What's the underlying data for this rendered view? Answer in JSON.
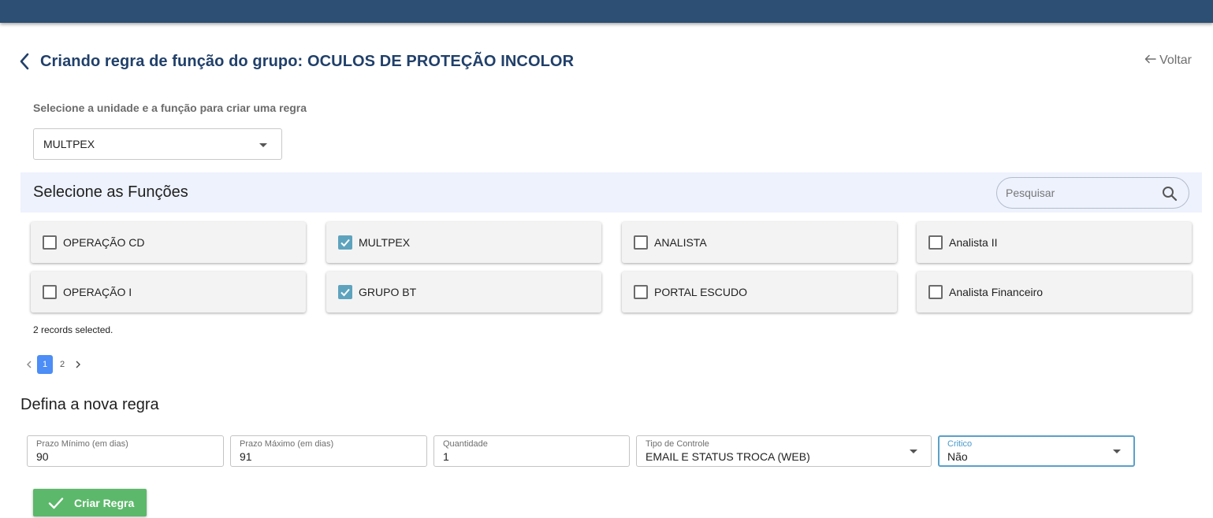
{
  "header": {
    "title": "Criando regra de função do grupo: OCULOS DE PROTEÇÃO INCOLOR",
    "back_link_label": "Voltar"
  },
  "unit": {
    "instruction": "Selecione a unidade e a função para criar uma regra",
    "selected": "MULTPEX"
  },
  "functions": {
    "title": "Selecione as Funções",
    "search_placeholder": "Pesquisar",
    "items": [
      {
        "label": "OPERAÇÃO CD",
        "checked": false
      },
      {
        "label": "MULTPEX",
        "checked": true
      },
      {
        "label": "ANALISTA",
        "checked": false
      },
      {
        "label": "Analista II",
        "checked": false
      },
      {
        "label": "OPERAÇÃO I",
        "checked": false
      },
      {
        "label": "GRUPO BT",
        "checked": true
      },
      {
        "label": "PORTAL ESCUDO",
        "checked": false
      },
      {
        "label": "Analista Financeiro",
        "checked": false
      }
    ],
    "records_selected": "2 records selected.",
    "pagination": {
      "pages": [
        "1",
        "2"
      ],
      "current": "1"
    }
  },
  "rule": {
    "title": "Defina a nova regra",
    "fields": [
      {
        "label": "Prazo Mínimo (em dias)",
        "value": "90"
      },
      {
        "label": "Prazo Máximo (em dias)",
        "value": "91"
      },
      {
        "label": "Quantidade",
        "value": "1"
      },
      {
        "label": "Tipo de Controle",
        "value": "EMAIL E STATUS TROCA (WEB)"
      },
      {
        "label": "Critico",
        "value": "Não"
      }
    ],
    "submit_label": "Criar Regra"
  },
  "colors": {
    "topbar": "#2c4f73",
    "title": "#21406a",
    "checkbox_checked": "#5ea3be",
    "pager_active": "#4c8df6",
    "submit": "#5cb86a",
    "focus": "#5aa0c9"
  }
}
